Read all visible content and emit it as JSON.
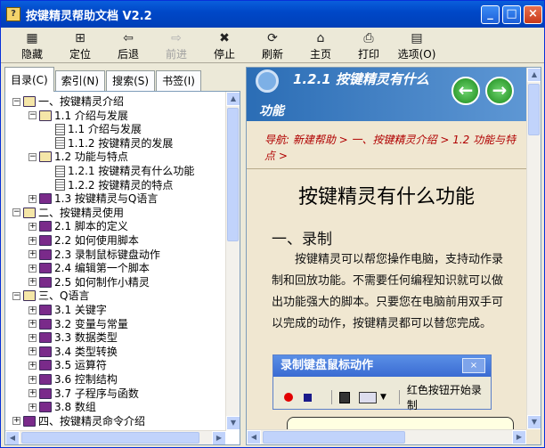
{
  "window": {
    "title": "按键精灵帮助文档 V2.2",
    "icon": "help-book-icon",
    "buttons": [
      "_",
      "□",
      "×"
    ]
  },
  "toolbar": [
    {
      "label": "隐藏",
      "icon": "hide-pane-icon",
      "enabled": true
    },
    {
      "label": "定位",
      "icon": "locate-icon",
      "enabled": true
    },
    {
      "label": "后退",
      "icon": "back-arrow-icon",
      "enabled": true
    },
    {
      "label": "前进",
      "icon": "forward-arrow-icon",
      "enabled": false
    },
    {
      "label": "停止",
      "icon": "stop-icon",
      "enabled": true
    },
    {
      "label": "刷新",
      "icon": "refresh-icon",
      "enabled": true
    },
    {
      "label": "主页",
      "icon": "home-icon",
      "enabled": true
    },
    {
      "label": "打印",
      "icon": "print-icon",
      "enabled": true
    },
    {
      "label": "选项(O)",
      "icon": "options-icon",
      "enabled": true
    }
  ],
  "tabs": [
    {
      "label": "目录(C)",
      "active": true
    },
    {
      "label": "索引(N)",
      "active": false
    },
    {
      "label": "搜索(S)",
      "active": false
    },
    {
      "label": "书签(I)",
      "active": false
    }
  ],
  "tree": [
    {
      "label": "一、按键精灵介绍",
      "level": 0,
      "type": "book-open",
      "expander": "−"
    },
    {
      "label": "1.1 介绍与发展",
      "level": 1,
      "type": "book-open",
      "expander": "−"
    },
    {
      "label": "1.1 介绍与发展",
      "level": 2,
      "type": "page",
      "expander": ""
    },
    {
      "label": "1.1.2 按键精灵的发展",
      "level": 2,
      "type": "page",
      "expander": ""
    },
    {
      "label": "1.2 功能与特点",
      "level": 1,
      "type": "book-open",
      "expander": "−"
    },
    {
      "label": "1.2.1 按键精灵有什么功能",
      "level": 2,
      "type": "page",
      "expander": ""
    },
    {
      "label": "1.2.2 按键精灵的特点",
      "level": 2,
      "type": "page",
      "expander": ""
    },
    {
      "label": "1.3 按键精灵与Q语言",
      "level": 1,
      "type": "book",
      "expander": "+"
    },
    {
      "label": "二、按键精灵使用",
      "level": 0,
      "type": "book-open",
      "expander": "−"
    },
    {
      "label": "2.1 脚本的定义",
      "level": 1,
      "type": "book",
      "expander": "+"
    },
    {
      "label": "2.2 如何使用脚本",
      "level": 1,
      "type": "book",
      "expander": "+"
    },
    {
      "label": "2.3 录制鼠标键盘动作",
      "level": 1,
      "type": "book",
      "expander": "+"
    },
    {
      "label": "2.4 编辑第一个脚本",
      "level": 1,
      "type": "book",
      "expander": "+"
    },
    {
      "label": "2.5 如何制作小精灵",
      "level": 1,
      "type": "book",
      "expander": "+"
    },
    {
      "label": "三、Q语言",
      "level": 0,
      "type": "book-open",
      "expander": "−"
    },
    {
      "label": "3.1 关键字",
      "level": 1,
      "type": "book",
      "expander": "+"
    },
    {
      "label": "3.2 变量与常量",
      "level": 1,
      "type": "book",
      "expander": "+"
    },
    {
      "label": "3.3 数据类型",
      "level": 1,
      "type": "book",
      "expander": "+"
    },
    {
      "label": "3.4 类型转换",
      "level": 1,
      "type": "book",
      "expander": "+"
    },
    {
      "label": "3.5 运算符",
      "level": 1,
      "type": "book",
      "expander": "+"
    },
    {
      "label": "3.6 控制结构",
      "level": 1,
      "type": "book",
      "expander": "+"
    },
    {
      "label": "3.7 子程序与函数",
      "level": 1,
      "type": "book",
      "expander": "+"
    },
    {
      "label": "3.8 数组",
      "level": 1,
      "type": "book",
      "expander": "+"
    },
    {
      "label": "四、按键精灵命令介绍",
      "level": 0,
      "type": "book",
      "expander": "+"
    }
  ],
  "content": {
    "header_title_line1": "1.2.1 按键精灵有什么",
    "header_title_line2": "功能",
    "back_button": "←",
    "forward_button": "→",
    "breadcrumb": "导航: 新建帮助 > 一、按键精灵介绍 > 1.2 功能与特点 >",
    "article_title": "按键精灵有什么功能",
    "section_heading": "一、录制",
    "paragraph": "按键精灵可以帮您操作电脑，支持动作录制和回放功能。不需要任何编程知识就可以做出功能强大的脚本。只要您在电脑前用双手可以完成的动作，按键精灵都可以替您完成。",
    "figure": {
      "title": "录制键盘鼠标动作",
      "close": "×",
      "hint": "红色按钮开始录制"
    }
  },
  "colors": {
    "title_bar": "#0a5fdc",
    "header_band": "#2b6db5",
    "breadcrumb": "#b00000",
    "content_bg": "#f0e7d1"
  }
}
